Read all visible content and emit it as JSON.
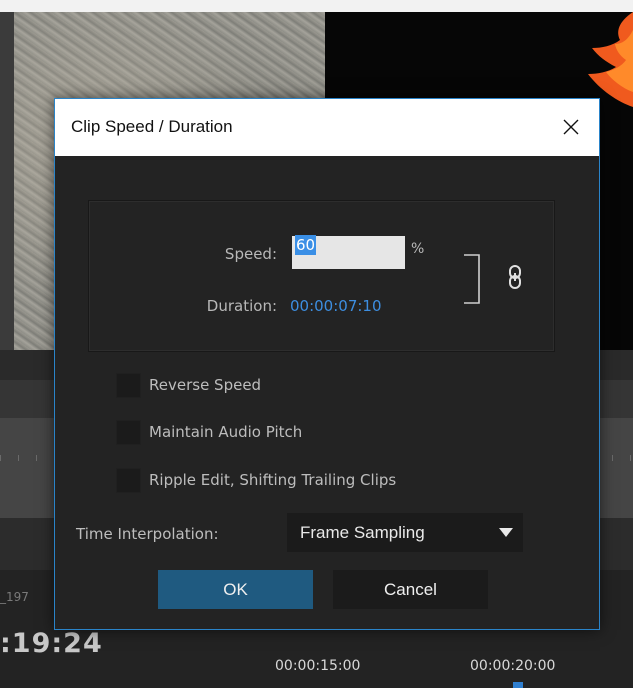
{
  "background": {
    "clip_name_fragment": "_197",
    "timecode": ":19:24",
    "ruler_ticks": [
      "00:00:15:00",
      "00:00:20:00"
    ]
  },
  "dialog": {
    "title": "Clip Speed / Duration",
    "close_icon": "close-icon",
    "speed_label": "Speed:",
    "speed_value": "60",
    "speed_unit": "%",
    "duration_label": "Duration:",
    "duration_value": "00:00:07:10",
    "link_icon": "chain-link-icon",
    "options": [
      {
        "label": "Reverse Speed",
        "checked": false
      },
      {
        "label": "Maintain Audio Pitch",
        "checked": false
      },
      {
        "label": "Ripple Edit, Shifting Trailing Clips",
        "checked": false
      }
    ],
    "interpolation_label": "Time Interpolation:",
    "interpolation_value": "Frame Sampling",
    "ok_label": "OK",
    "cancel_label": "Cancel"
  },
  "colors": {
    "accent_blue": "#3d8ee0",
    "ok_button": "#1f5a80",
    "dialog_border": "#2a84c9",
    "dialog_bg": "#232323"
  }
}
